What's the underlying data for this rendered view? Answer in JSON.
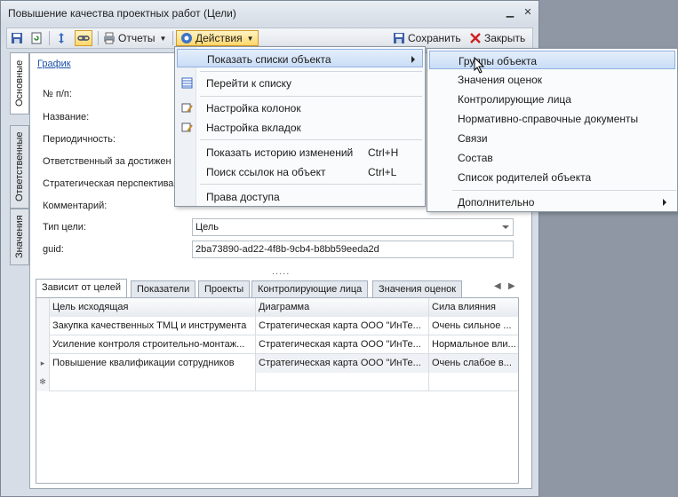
{
  "window": {
    "title": "Повышение качества проектных работ (Цели)",
    "minimize": "▁",
    "close": "✕"
  },
  "toolbar": {
    "reports_label": "Отчеты",
    "actions_label": "Действия",
    "save_label": "Сохранить",
    "close_label": "Закрыть"
  },
  "side_tabs": [
    "Основные",
    "Ответственные",
    "Значения"
  ],
  "form": {
    "chart_link": "График",
    "labels": {
      "number": "№ п/п:",
      "name": "Название:",
      "periodicity": "Периодичность:",
      "responsible": "Ответственный за достижен",
      "perspective": "Стратегическая перспектива",
      "comment": "Комментарий:",
      "goal_type": "Тип цели:",
      "guid": "guid:"
    },
    "goal_type_value": "Цель",
    "guid_value": "2ba73890-ad22-4f8b-9cb4-b8bb59eeda2d",
    "splitter": "....."
  },
  "tabs": {
    "items": [
      "Зависит от целей",
      "Показатели",
      "Проекты",
      "Контролирующие лица",
      "Значения оценок"
    ],
    "prev": "◀",
    "next": "▶"
  },
  "grid": {
    "headers": [
      "Цель исходящая",
      "Диаграмма",
      "Сила влияния"
    ],
    "rows": [
      [
        "Закупка качественных ТМЦ и инструмента",
        "Стратегическая карта ООО \"ИнТе...",
        "Очень сильное ..."
      ],
      [
        "Усиление контроля строительно-монтаж...",
        "Стратегическая карта ООО \"ИнТе...",
        "Нормальное вли..."
      ],
      [
        "Повышение квалификации сотрудников",
        "Стратегическая карта ООО \"ИнТе...",
        "Очень слабое в..."
      ]
    ],
    "current_marker": "▸",
    "new_row_marker": "✻"
  },
  "menu": {
    "items": {
      "show_lists": "Показать списки объекта",
      "goto_list": "Перейти к списку",
      "columns": "Настройка колонок",
      "tabs": "Настройка вкладок",
      "history": "Показать историю изменений",
      "history_key": "Ctrl+H",
      "search_links": "Поиск ссылок на объект",
      "search_key": "Ctrl+L",
      "access": "Права доступа"
    }
  },
  "submenu": {
    "items": [
      "Группы объекта",
      "Значения оценок",
      "Контролирующие лица",
      "Нормативно-справочные документы",
      "Связи",
      "Состав",
      "Список родителей объекта"
    ],
    "more": "Дополнительно"
  },
  "colors": {
    "accent": "#1a52a8",
    "highlight": "#c9ddf6",
    "window_bg": "#d6dde6"
  }
}
